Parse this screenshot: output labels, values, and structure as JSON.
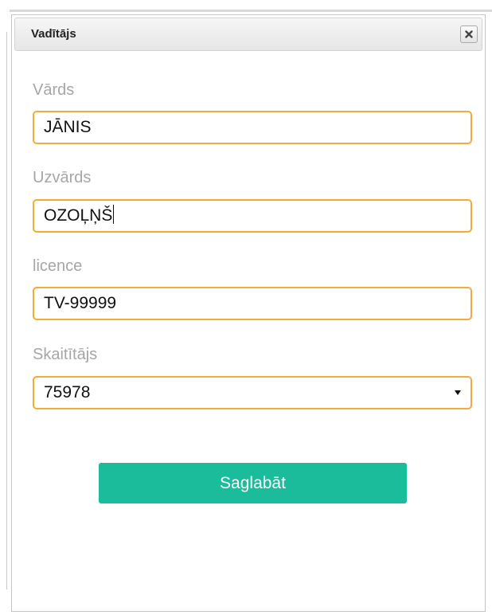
{
  "dialog": {
    "title": "Vadītājs",
    "close_icon": "close-icon"
  },
  "form": {
    "first_name": {
      "label": "Vārds",
      "value": "JĀNIS"
    },
    "last_name": {
      "label": "Uzvārds",
      "value": "OZOĻŅŠ"
    },
    "license": {
      "label": "licence",
      "value": "TV-99999"
    },
    "counter": {
      "label": "Skaitītājs",
      "selected": "75978",
      "icon": "chevron-down-icon"
    }
  },
  "actions": {
    "save_label": "Saglabāt"
  },
  "colors": {
    "accent_border": "#f2ab3b",
    "save_button": "#1abc9c",
    "label_text": "#a6a6a6"
  }
}
